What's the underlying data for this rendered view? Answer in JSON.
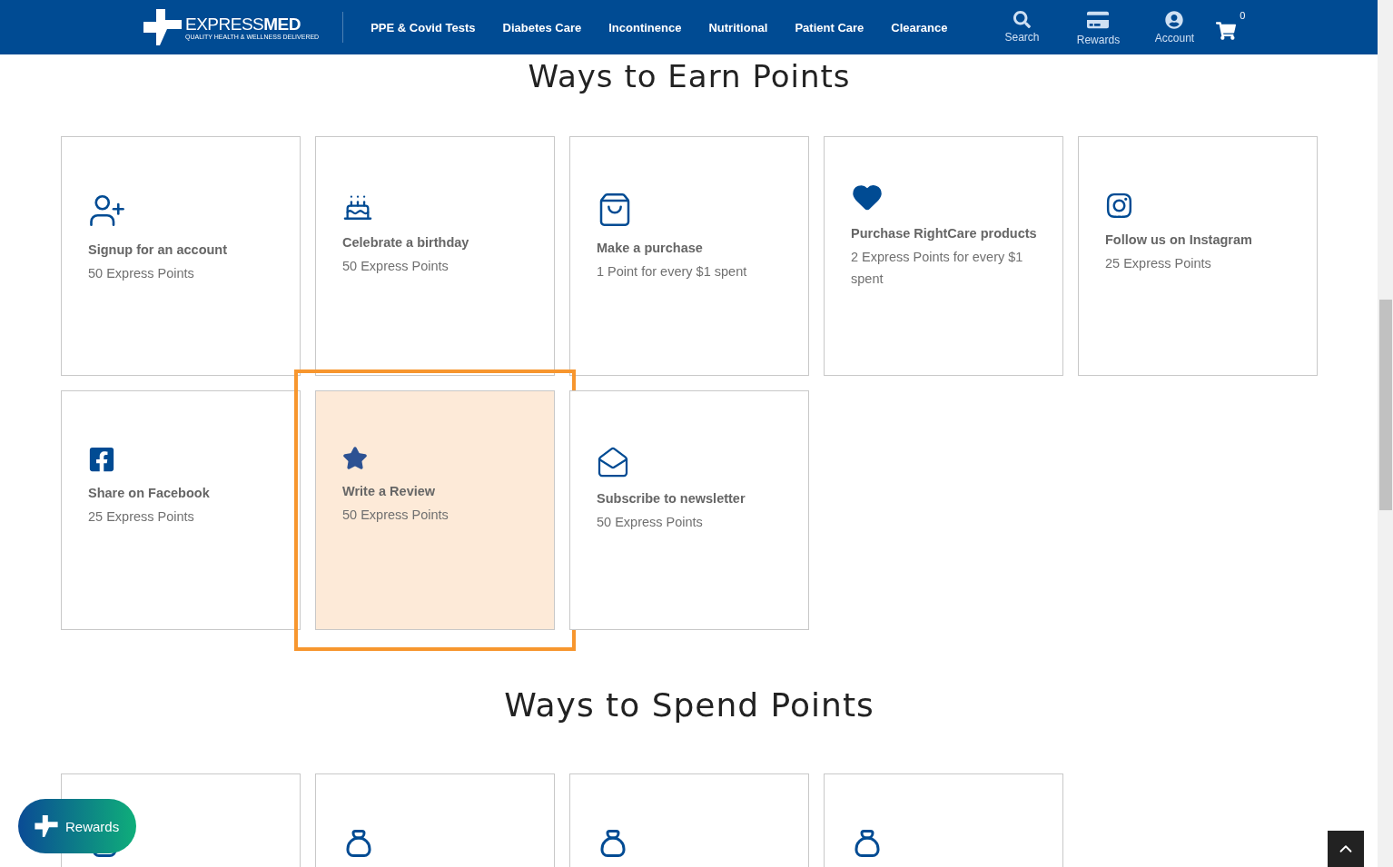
{
  "header": {
    "logo": {
      "word1": "EXPRESS",
      "word2": "MED",
      "tagline": "QUALITY HEALTH & WELLNESS DELIVERED"
    },
    "nav": [
      "PPE & Covid Tests",
      "Diabetes Care",
      "Incontinence",
      "Nutritional",
      "Patient Care",
      "Clearance"
    ],
    "actions": [
      {
        "label": "Search"
      },
      {
        "label": "Rewards"
      },
      {
        "label": "Account"
      }
    ],
    "cart_count": "0"
  },
  "earn": {
    "title": "Ways to Earn Points",
    "cards": [
      {
        "title": "Signup for an account",
        "points": "50 Express Points",
        "highlighted": false
      },
      {
        "title": "Celebrate a birthday",
        "points": "50 Express Points",
        "highlighted": false
      },
      {
        "title": "Make a purchase",
        "points": "1 Point for every $1 spent",
        "highlighted": false
      },
      {
        "title": "Purchase RightCare products",
        "points": "2 Express Points for every $1 spent",
        "highlighted": false
      },
      {
        "title": "Follow us on Instagram",
        "points": "25 Express Points",
        "highlighted": false
      },
      {
        "title": "Share on Facebook",
        "points": "25 Express Points",
        "highlighted": false
      },
      {
        "title": "Write a Review",
        "points": "50 Express Points",
        "highlighted": true
      },
      {
        "title": "Subscribe to newsletter",
        "points": "50 Express Points",
        "highlighted": false
      }
    ]
  },
  "spend": {
    "title": "Ways to Spend Points"
  },
  "rewards_button": {
    "label": "Rewards"
  }
}
